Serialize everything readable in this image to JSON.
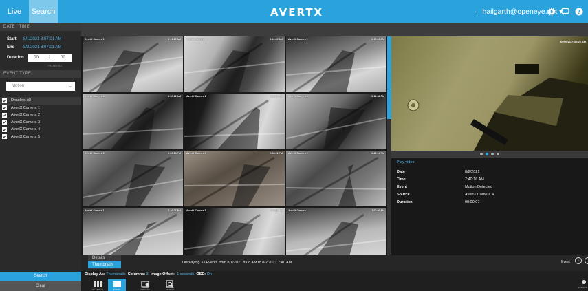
{
  "topbar": {
    "tabs": [
      "Live",
      "Search"
    ],
    "logo": "AVERTX",
    "user": "hailgarth@openeye.net",
    "colors": {
      "accent": "#2aa3dc"
    }
  },
  "sidebar": {
    "date_section": "DATE / TIME",
    "start_label": "Start",
    "start_value": "8/1/2021 8:07:01 AM",
    "end_label": "End",
    "end_value": "8/2/2021 8:07:01 AM",
    "duration_label": "Duration",
    "duration_value": {
      "hh": "00",
      "mm": "1",
      "ss": "00"
    },
    "duration_units": "HH  MM  SS",
    "event_section": "EVENT TYPE",
    "event_type": "Motion",
    "cameras": [
      "Deselect All",
      "AvertX Camera 1",
      "AvertX Camera 2",
      "AvertX Camera 3",
      "AvertX Camera 4",
      "AvertX Camera 5"
    ],
    "search_button": "Search",
    "clear_button": "Clear"
  },
  "thumbnails": [
    {
      "camera": "AvertX Camera 1",
      "time": "8:00:00 AM",
      "style": "t-a"
    },
    {
      "camera": "AvertX Camera 1",
      "time": "8:14:25 AM",
      "style": "t-b"
    },
    {
      "camera": "AvertX Camera 1",
      "time": "8:19:28 AM",
      "style": "t-a"
    },
    {
      "camera": "AvertX Camera 2",
      "time": "8:50:12 AM",
      "style": "t-c"
    },
    {
      "camera": "AvertX Camera 2",
      "time": "1:29:45 PM",
      "style": "t-d"
    },
    {
      "camera": "AvertX Camera 2",
      "time": "5:14:42 PM",
      "style": "t-c"
    },
    {
      "camera": "AvertX Camera 2",
      "time": "6:00:24 PM",
      "style": "t-e"
    },
    {
      "camera": "AvertX Camera 5",
      "time": "6:33:11 PM",
      "style": "t-g"
    },
    {
      "camera": "AvertX Camera 2",
      "time": "6:42:14 PM",
      "style": "t-e"
    },
    {
      "camera": "AvertX Camera 1",
      "time": "7:19:26 PM",
      "style": "t-f"
    },
    {
      "camera": "AvertX Camera 5",
      "time": "7:40:19 PM",
      "style": "t-d"
    },
    {
      "camera": "AvertX Camera 1",
      "time": "7:50:08 PM",
      "style": "t-f"
    }
  ],
  "preview": {
    "time": "8/2/2021 7:40:22 AM",
    "play_link": "Play video",
    "fields": [
      {
        "label": "Date",
        "value": "8/2/2021"
      },
      {
        "label": "Time",
        "value": "7:40:16 AM"
      },
      {
        "label": "Event",
        "value": "Motion Detected"
      },
      {
        "label": "Source",
        "value": "AvertX Camera 4"
      },
      {
        "label": "Duration",
        "value": "00:00:07"
      }
    ]
  },
  "status": {
    "text": "Displaying 33 Events from 8/1/2021 8:08 AM to 8/2/2021 7:40 AM",
    "event_label": "Event",
    "display_options": [
      "Details",
      "Thumbnails"
    ]
  },
  "options": {
    "display_as_label": "Display As:",
    "display_as_value": "Thumbnails",
    "columns_label": "Columns:",
    "columns_value": "3",
    "offset_label": "Image Offset:",
    "offset_value": "-1 seconds",
    "osd_label": "OSD:",
    "osd_value": "On"
  },
  "modes": [
    "THUMBNAIL",
    "EVENT",
    "TIMELINE",
    "OBJECT"
  ],
  "export_label": "EXPORT"
}
